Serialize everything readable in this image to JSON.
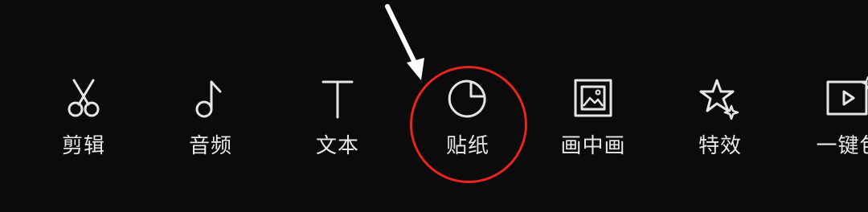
{
  "toolbar": {
    "items": [
      {
        "label": "剪辑",
        "icon": "scissors-icon"
      },
      {
        "label": "音频",
        "icon": "music-note-icon"
      },
      {
        "label": "文本",
        "icon": "text-t-icon"
      },
      {
        "label": "贴纸",
        "icon": "sticker-icon"
      },
      {
        "label": "画中画",
        "icon": "picture-in-picture-icon"
      },
      {
        "label": "特效",
        "icon": "star-sparkle-icon"
      },
      {
        "label": "一键包",
        "icon": "one-click-package-icon"
      }
    ]
  },
  "annotations": {
    "highlight_color": "#e8251f",
    "arrow_color": "#ffffff",
    "highlighted_item": "贴纸"
  }
}
